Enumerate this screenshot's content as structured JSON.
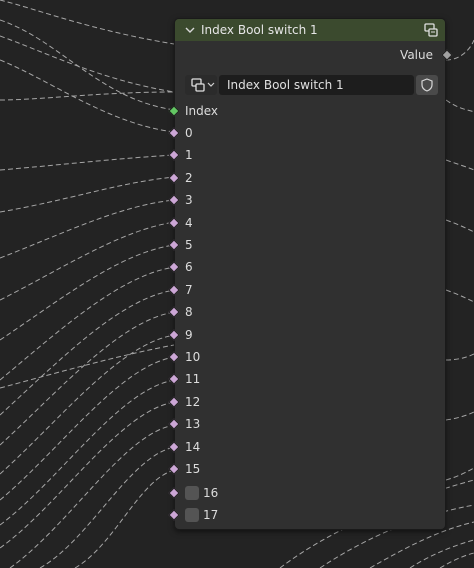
{
  "node": {
    "title": "Index Bool switch 1",
    "header_color": "#3b4a2e",
    "output": {
      "label": "Value",
      "socket_color": "#a1a1a1"
    },
    "datablock": {
      "name": "Index Bool switch 1",
      "icon": "node-tree-icon",
      "fake_user_icon": "shield-icon"
    },
    "index_input": {
      "label": "Index",
      "socket_color": "#63c763"
    },
    "bool_socket_color": "#cca6d6",
    "inputs": [
      {
        "label": "0"
      },
      {
        "label": "1"
      },
      {
        "label": "2"
      },
      {
        "label": "3"
      },
      {
        "label": "4"
      },
      {
        "label": "5"
      },
      {
        "label": "6"
      },
      {
        "label": "7"
      },
      {
        "label": "8"
      },
      {
        "label": "9"
      },
      {
        "label": "10"
      },
      {
        "label": "11"
      },
      {
        "label": "12"
      },
      {
        "label": "13"
      },
      {
        "label": "14"
      },
      {
        "label": "15"
      }
    ],
    "checkbox_inputs": [
      {
        "label": "16",
        "checked": false
      },
      {
        "label": "17",
        "checked": false
      }
    ]
  },
  "canvas": {
    "background": "#232323",
    "wire_color": "#bdbdbd"
  }
}
